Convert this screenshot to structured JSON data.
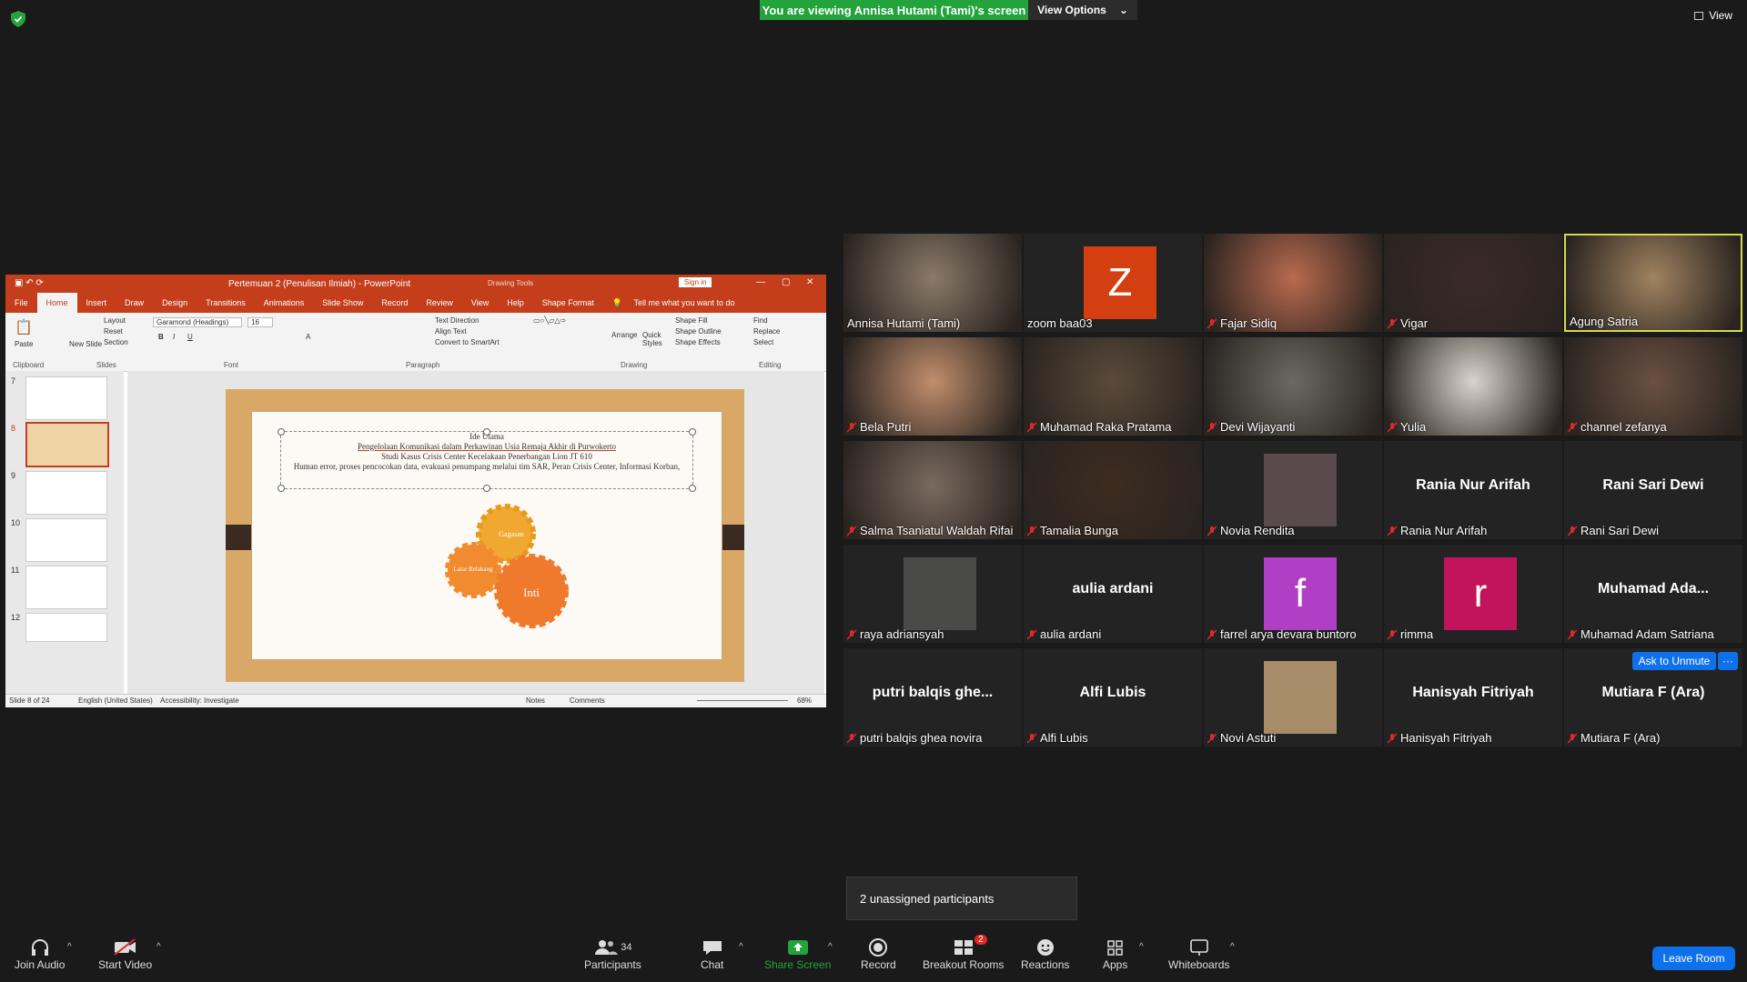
{
  "top": {
    "banner": "You are viewing Annisa Hutami (Tami)'s screen",
    "view_options": "View Options",
    "view": "View"
  },
  "powerpoint": {
    "title": "Pertemuan 2 (Penulisan Ilmiah) - PowerPoint",
    "drawing_tools": "Drawing Tools",
    "sign_in": "Sign in",
    "tabs": [
      "File",
      "Home",
      "Insert",
      "Draw",
      "Design",
      "Transitions",
      "Animations",
      "Slide Show",
      "Record",
      "Review",
      "View",
      "Help",
      "Shape Format"
    ],
    "tell_me": "Tell me what you want to do",
    "ribbon": {
      "paste": "Paste",
      "new_slide": "New Slide",
      "layout": "Layout",
      "reset": "Reset",
      "section": "Section",
      "font_name": "Garamond (Headings)",
      "font_size": "16",
      "text_direction": "Text Direction",
      "align_text": "Align Text",
      "convert_smartart": "Convert to SmartArt",
      "arrange": "Arrange",
      "quick_styles": "Quick Styles",
      "shape_fill": "Shape Fill",
      "shape_outline": "Shape Outline",
      "shape_effects": "Shape Effects",
      "find": "Find",
      "replace": "Replace",
      "select": "Select",
      "groups": [
        "Clipboard",
        "Slides",
        "Font",
        "Paragraph",
        "Drawing",
        "Editing"
      ]
    },
    "slide_numbers": [
      "7",
      "8",
      "9",
      "10",
      "11",
      "12"
    ],
    "slide": {
      "line1": "Ide Utama",
      "line2": "Pengelolaan Komunikasi dalam Perkawinan Usia Remaja Akhir di Purwokerto",
      "line3": "Studi Kasus Crisis Center Kecelakaan Penerbangan Lion JT 610",
      "line4": "Human error, proses pencocokan data, evakuasi penumpang melalui tim SAR, Peran Crisis Center, Informasi Korban,",
      "gear_top": "Gagasan",
      "gear_left": "Latar Belakang",
      "gear_main": "Inti"
    },
    "status": {
      "slide_of": "Slide 8 of 24",
      "language": "English (United States)",
      "accessibility": "Accessibility: Investigate",
      "notes": "Notes",
      "comments": "Comments",
      "zoom": "68%"
    }
  },
  "participants": [
    {
      "name": "Annisa Hutami (Tami)",
      "type": "photo",
      "muted": false,
      "bg": "#8a7a6a"
    },
    {
      "name": "zoom baa03",
      "type": "avatar",
      "letter": "Z",
      "color": "#d43f12",
      "muted": false
    },
    {
      "name": "Fajar Sidiq",
      "type": "photo",
      "muted": true,
      "bg": "#b96a4e"
    },
    {
      "name": "Vigar",
      "type": "photo",
      "muted": true,
      "bg": "#3a2a28"
    },
    {
      "name": "Agung Satria",
      "type": "photo",
      "muted": false,
      "bg": "#a08360",
      "speaking": true
    },
    {
      "name": "Bela Putri",
      "type": "photo",
      "muted": true,
      "bg": "#c08e6d"
    },
    {
      "name": "Muhamad Raka Pratama",
      "type": "photo",
      "muted": true,
      "bg": "#5a4a3a"
    },
    {
      "name": "Devi Wijayanti",
      "type": "photo",
      "muted": true,
      "bg": "#6a6a62"
    },
    {
      "name": "Yulia",
      "type": "photo",
      "muted": true,
      "bg": "#d9d4cb"
    },
    {
      "name": "channel zefanya",
      "type": "photo",
      "muted": true,
      "bg": "#6a5042"
    },
    {
      "name": "Salma Tsaniatul Waldah Rifai",
      "type": "photo",
      "muted": true,
      "bg": "#7a6a5e"
    },
    {
      "name": "Tamalia Bunga",
      "type": "photo",
      "muted": true,
      "bg": "#3d2c20"
    },
    {
      "name": "Novia Rendita",
      "type": "small-photo",
      "muted": true,
      "bg": "#5a4a4e"
    },
    {
      "name": "Rania Nur Arifah",
      "type": "text",
      "label": "Rania Nur Arifah",
      "muted": true
    },
    {
      "name": "Rani Sari Dewi",
      "type": "text",
      "label": "Rani Sari Dewi",
      "muted": true
    },
    {
      "name": "raya adriansyah",
      "type": "small-photo",
      "muted": true,
      "bg": "#4a4a48"
    },
    {
      "name": "aulia ardani",
      "type": "text",
      "label": "aulia ardani",
      "muted": true
    },
    {
      "name": "farrel arya devara buntoro",
      "type": "avatar",
      "letter": "f",
      "color": "#b13fc5",
      "muted": true
    },
    {
      "name": "rimma",
      "type": "avatar",
      "letter": "r",
      "color": "#c2145a",
      "muted": true
    },
    {
      "name": "Muhamad Adam Satriana",
      "type": "text",
      "label": "Muhamad  Ada...",
      "muted": true
    },
    {
      "name": "putri balqis ghea novira",
      "type": "text",
      "label": "putri  balqis  ghe...",
      "muted": true
    },
    {
      "name": "Alfi Lubis",
      "type": "text",
      "label": "Alfi Lubis",
      "muted": true
    },
    {
      "name": "Novi Astuti",
      "type": "small-photo",
      "muted": true,
      "bg": "#a88c6a"
    },
    {
      "name": "Hanisyah Fitriyah",
      "type": "text",
      "label": "Hanisyah Fitriyah",
      "muted": true
    },
    {
      "name": "Mutiara F (Ara)",
      "type": "text",
      "label": "Mutiara F (Ara)",
      "muted": true
    }
  ],
  "ask_to_unmute": "Ask to Unmute",
  "more_dots": "···",
  "unassigned": "2 unassigned participants",
  "toolbar": {
    "join_audio": "Join Audio",
    "start_video": "Start Video",
    "participants": "Participants",
    "participant_count": "34",
    "chat": "Chat",
    "share_screen": "Share Screen",
    "record": "Record",
    "breakout_rooms": "Breakout Rooms",
    "breakout_badge": "2",
    "reactions": "Reactions",
    "apps": "Apps",
    "whiteboards": "Whiteboards",
    "leave": "Leave Room"
  },
  "colors": {
    "share_green": "#23a33b",
    "zoom_blue": "#0e71eb",
    "ppt_red": "#c43e1c",
    "active_speaker": "#d6d94a"
  }
}
